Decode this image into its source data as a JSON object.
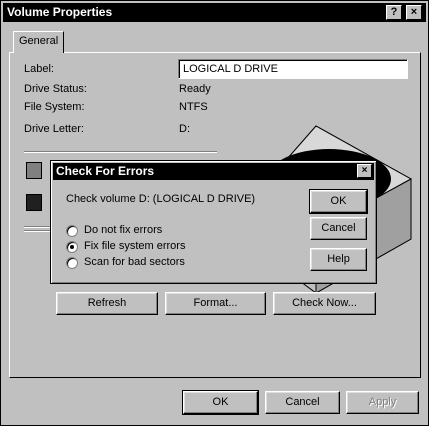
{
  "window": {
    "title": "Volume Properties",
    "help_btn": "?",
    "close_btn": "×"
  },
  "tabs": [
    "General"
  ],
  "general": {
    "label_label": "Label:",
    "label_value": "LOGICAL D DRIVE",
    "status_label": "Drive Status:",
    "status_value": "Ready",
    "fs_label": "File System:",
    "fs_value": "NTFS",
    "letter_label": "Drive Letter:",
    "letter_value": "D:",
    "swatch_colors": [
      "#808080",
      "#202020"
    ]
  },
  "panel_buttons": {
    "refresh": "Refresh",
    "format": "Format...",
    "check_now": "Check Now..."
  },
  "footer": {
    "ok": "OK",
    "cancel": "Cancel",
    "apply": "Apply"
  },
  "dialog": {
    "title": "Check For Errors",
    "close": "×",
    "message": "Check volume D: (LOGICAL D DRIVE)",
    "options": [
      {
        "label": "Do not fix errors",
        "selected": false
      },
      {
        "label": "Fix file system errors",
        "selected": true
      },
      {
        "label": "Scan for bad sectors",
        "selected": false
      }
    ],
    "ok": "OK",
    "cancel": "Cancel",
    "help": "Help"
  }
}
